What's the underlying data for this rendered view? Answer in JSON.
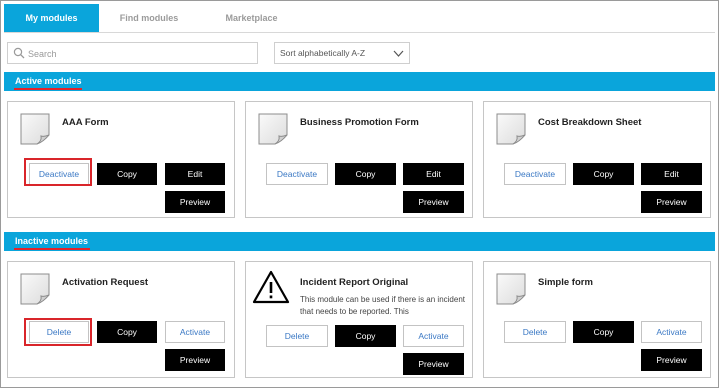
{
  "tabs": [
    {
      "label": "My modules",
      "active": true
    },
    {
      "label": "Find modules",
      "active": false
    },
    {
      "label": "Marketplace",
      "active": false
    }
  ],
  "search": {
    "placeholder": "Search",
    "icon": "search-icon"
  },
  "sort": {
    "selected": "Sort alphabetically A-Z",
    "icon": "chevron-down-icon"
  },
  "colors": {
    "accent": "#0aa5db",
    "highlight": "#d9252a",
    "link": "#3a78c4"
  },
  "active_section": {
    "title": "Active modules",
    "cards": [
      {
        "title": "AAA Form",
        "buttons": {
          "deactivate": "Deactivate",
          "copy": "Copy",
          "edit": "Edit",
          "preview": "Preview"
        }
      },
      {
        "title": "Business Promotion Form",
        "buttons": {
          "deactivate": "Deactivate",
          "copy": "Copy",
          "edit": "Edit",
          "preview": "Preview"
        }
      },
      {
        "title": "Cost Breakdown Sheet",
        "buttons": {
          "deactivate": "Deactivate",
          "copy": "Copy",
          "edit": "Edit",
          "preview": "Preview"
        }
      }
    ]
  },
  "inactive_section": {
    "title": "Inactive modules",
    "cards": [
      {
        "title": "Activation Request",
        "buttons": {
          "delete": "Delete",
          "copy": "Copy",
          "activate": "Activate",
          "preview": "Preview"
        }
      },
      {
        "title": "Incident Report Original",
        "description": "This module can be used if there is an incident that needs to be reported. This",
        "icon": "warning-icon",
        "buttons": {
          "delete": "Delete",
          "copy": "Copy",
          "activate": "Activate",
          "preview": "Preview"
        }
      },
      {
        "title": "Simple form",
        "buttons": {
          "delete": "Delete",
          "copy": "Copy",
          "activate": "Activate",
          "preview": "Preview"
        }
      }
    ]
  }
}
